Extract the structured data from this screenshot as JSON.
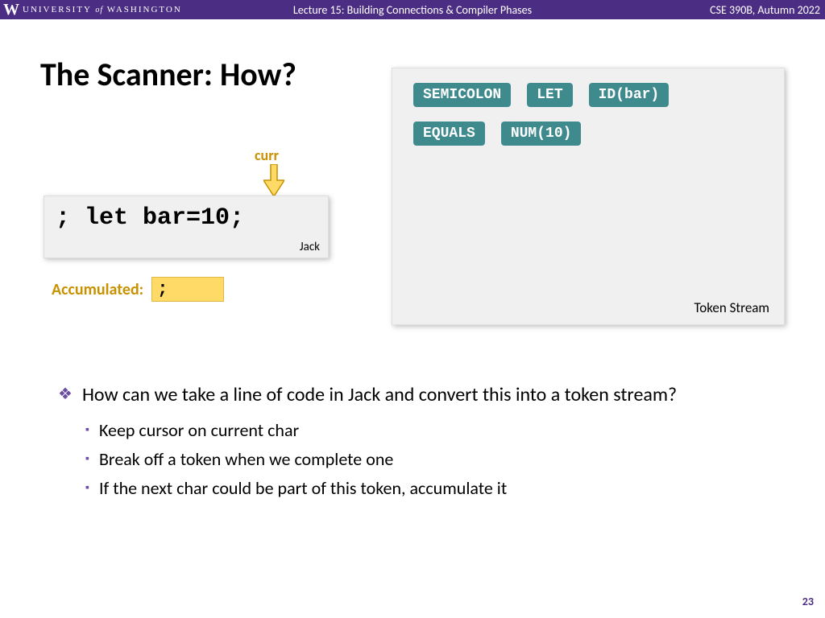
{
  "header": {
    "university_1": "UNIVERSITY",
    "university_of": "of",
    "university_2": "WASHINGTON",
    "lecture": "Lecture 15: Building Connections & Compiler Phases",
    "course": "CSE 390B, Autumn 2022"
  },
  "title": "The Scanner: How?",
  "curr_label": "curr",
  "code": {
    "text": "; let bar=10;",
    "lang": "Jack"
  },
  "accumulated": {
    "label": "Accumulated:",
    "value": ";"
  },
  "tokens": {
    "row1": [
      "SEMICOLON",
      "LET",
      "ID(bar)"
    ],
    "row2": [
      "EQUALS",
      "NUM(10)"
    ],
    "panel_label": "Token Stream"
  },
  "bullets": {
    "main": "How can we take a line of code in Jack and convert this into a token stream?",
    "subs": [
      "Keep cursor on current char",
      "Break off a token when we complete one",
      "If the next char could be part of this token, accumulate it"
    ]
  },
  "page_number": "23"
}
